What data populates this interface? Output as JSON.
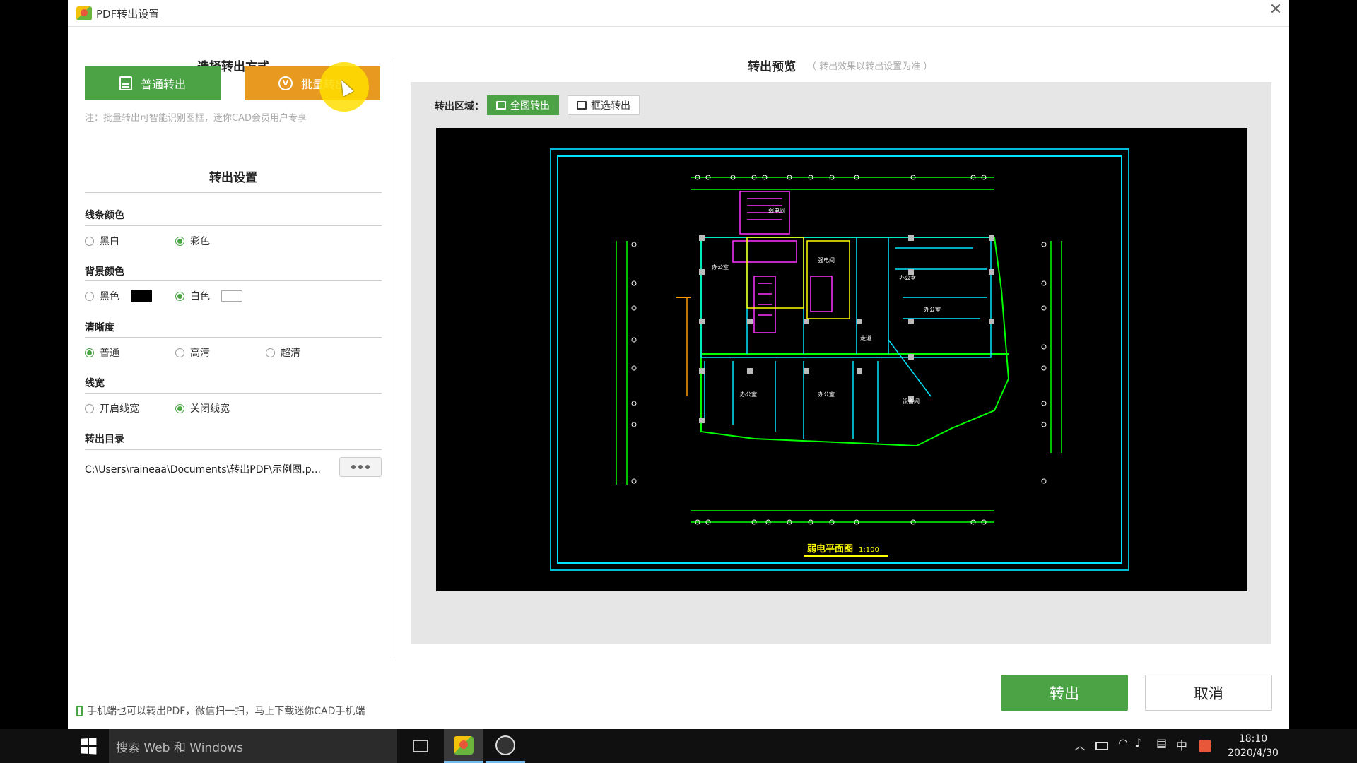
{
  "window": {
    "title": "PDF转出设置",
    "close": "✕"
  },
  "export_mode": {
    "heading": "选择转出方式",
    "normal_label": "普通转出",
    "batch_label": "批量转出",
    "batch_icon_text": "V",
    "note": "注：批量转出可智能识别图框，迷你CAD会员用户专享"
  },
  "settings": {
    "heading": "转出设置",
    "line_color": {
      "label": "线条颜色",
      "options": [
        "黑白",
        "彩色"
      ],
      "selected": "彩色"
    },
    "bg_color": {
      "label": "背景颜色",
      "options": [
        "黑色",
        "白色"
      ],
      "selected": "白色",
      "swatches": [
        "#000000",
        "#ffffff"
      ]
    },
    "clarity": {
      "label": "清晰度",
      "options": [
        "普通",
        "高清",
        "超清"
      ],
      "selected": "普通"
    },
    "line_width": {
      "label": "线宽",
      "options": [
        "开启线宽",
        "关闭线宽"
      ],
      "selected": "关闭线宽"
    },
    "output_dir": {
      "label": "转出目录",
      "value": "C:\\Users\\raineaa\\Documents\\转出PDF\\示例图.p..."
    }
  },
  "preview": {
    "title": "转出预览",
    "subtitle": "（ 转出效果以转出设置为准 ）",
    "area_label": "转出区域：",
    "full_label": "全图转出",
    "frame_label": "框选转出",
    "drawing_title": "弱电平面图",
    "drawing_scale": "1:100",
    "room_labels": [
      "弱电间",
      "强电间",
      "走道",
      "办公室",
      "办公室",
      "办公室",
      "办公室",
      "办公室",
      "设备间"
    ]
  },
  "actions": {
    "export_label": "转出",
    "cancel_label": "取消"
  },
  "footer_tip": "手机端也可以转出PDF，微信扫一扫，马上下载迷你CAD手机端",
  "taskbar": {
    "search_placeholder": "搜索 Web 和 Windows",
    "tray_ime": "中",
    "time": "18:10",
    "date": "2020/4/30"
  },
  "colors": {
    "accent_green": "#4ba346",
    "accent_orange": "#e79a1f",
    "cad_cyan": "#00ffff",
    "cad_magenta": "#ff00ff",
    "cad_green": "#00ff00",
    "cad_yellow": "#ffff00"
  }
}
